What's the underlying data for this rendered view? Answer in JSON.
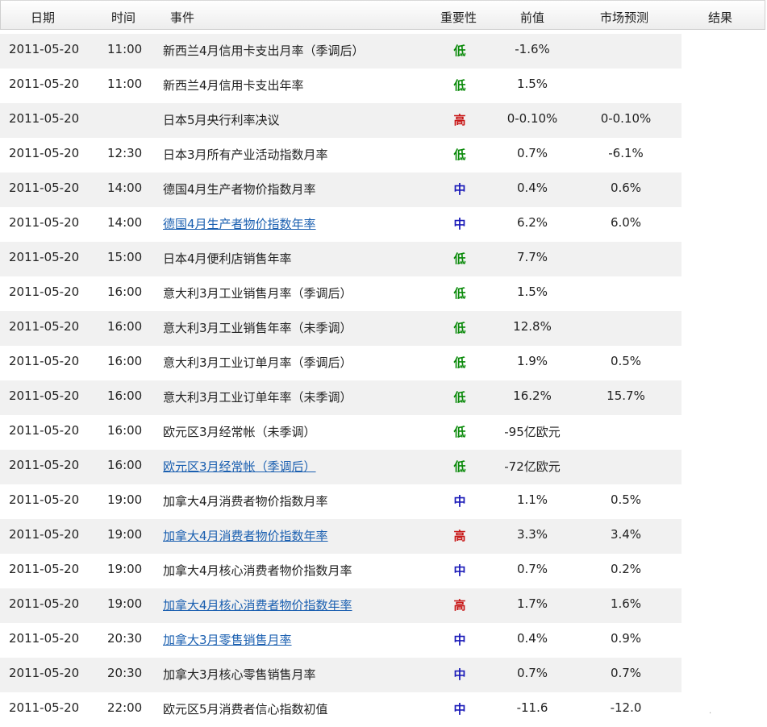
{
  "header": {
    "date": "日期",
    "time": "时间",
    "event": "事件",
    "importance": "重要性",
    "previous": "前值",
    "forecast": "市场预测",
    "result": "结果"
  },
  "rows": [
    {
      "date": "2011-05-20",
      "time": "11:00",
      "event": "新西兰4月信用卡支出月率（季调后）",
      "importance": "低",
      "previous": "-1.6%",
      "forecast": "",
      "link": false
    },
    {
      "date": "2011-05-20",
      "time": "11:00",
      "event": "新西兰4月信用卡支出年率",
      "importance": "低",
      "previous": "1.5%",
      "forecast": "",
      "link": false
    },
    {
      "date": "2011-05-20",
      "time": "",
      "event": "日本5月央行利率决议",
      "importance": "高",
      "previous": "0-0.10%",
      "forecast": "0-0.10%",
      "link": false
    },
    {
      "date": "2011-05-20",
      "time": "12:30",
      "event": "日本3月所有产业活动指数月率",
      "importance": "低",
      "previous": "0.7%",
      "forecast": "-6.1%",
      "link": false
    },
    {
      "date": "2011-05-20",
      "time": "14:00",
      "event": "德国4月生产者物价指数月率",
      "importance": "中",
      "previous": "0.4%",
      "forecast": "0.6%",
      "link": false
    },
    {
      "date": "2011-05-20",
      "time": "14:00",
      "event": "德国4月生产者物价指数年率",
      "importance": "中",
      "previous": "6.2%",
      "forecast": "6.0%",
      "link": true
    },
    {
      "date": "2011-05-20",
      "time": "15:00",
      "event": "日本4月便利店销售年率",
      "importance": "低",
      "previous": "7.7%",
      "forecast": "",
      "link": false
    },
    {
      "date": "2011-05-20",
      "time": "16:00",
      "event": "意大利3月工业销售月率（季调后）",
      "importance": "低",
      "previous": "1.5%",
      "forecast": "",
      "link": false
    },
    {
      "date": "2011-05-20",
      "time": "16:00",
      "event": "意大利3月工业销售年率（未季调）",
      "importance": "低",
      "previous": "12.8%",
      "forecast": "",
      "link": false
    },
    {
      "date": "2011-05-20",
      "time": "16:00",
      "event": "意大利3月工业订单月率（季调后）",
      "importance": "低",
      "previous": "1.9%",
      "forecast": "0.5%",
      "link": false
    },
    {
      "date": "2011-05-20",
      "time": "16:00",
      "event": "意大利3月工业订单年率（未季调）",
      "importance": "低",
      "previous": "16.2%",
      "forecast": "15.7%",
      "link": false
    },
    {
      "date": "2011-05-20",
      "time": "16:00",
      "event": "欧元区3月经常帐（未季调）",
      "importance": "低",
      "previous": "-95亿欧元",
      "forecast": "",
      "link": false
    },
    {
      "date": "2011-05-20",
      "time": "16:00",
      "event": "欧元区3月经常帐（季调后）",
      "importance": "低",
      "previous": "-72亿欧元",
      "forecast": "",
      "link": true
    },
    {
      "date": "2011-05-20",
      "time": "19:00",
      "event": "加拿大4月消费者物价指数月率",
      "importance": "中",
      "previous": "1.1%",
      "forecast": "0.5%",
      "link": false
    },
    {
      "date": "2011-05-20",
      "time": "19:00",
      "event": "加拿大4月消费者物价指数年率",
      "importance": "高",
      "previous": "3.3%",
      "forecast": "3.4%",
      "link": true
    },
    {
      "date": "2011-05-20",
      "time": "19:00",
      "event": "加拿大4月核心消费者物价指数月率",
      "importance": "中",
      "previous": "0.7%",
      "forecast": "0.2%",
      "link": false
    },
    {
      "date": "2011-05-20",
      "time": "19:00",
      "event": "加拿大4月核心消费者物价指数年率",
      "importance": "高",
      "previous": "1.7%",
      "forecast": "1.6%",
      "link": true
    },
    {
      "date": "2011-05-20",
      "time": "20:30",
      "event": "加拿大3月零售销售月率",
      "importance": "中",
      "previous": "0.4%",
      "forecast": "0.9%",
      "link": true
    },
    {
      "date": "2011-05-20",
      "time": "20:30",
      "event": "加拿大3月核心零售销售月率",
      "importance": "中",
      "previous": "0.7%",
      "forecast": "0.7%",
      "link": false
    },
    {
      "date": "2011-05-20",
      "time": "22:00",
      "event": "欧元区5月消费者信心指数初值",
      "importance": "中",
      "previous": "-11.6",
      "forecast": "-12.0",
      "link": false
    }
  ],
  "importance_colors": {
    "低": "#0a8a0a",
    "中": "#1a1ab8",
    "高": "#c81616"
  },
  "corner_mark": "·"
}
